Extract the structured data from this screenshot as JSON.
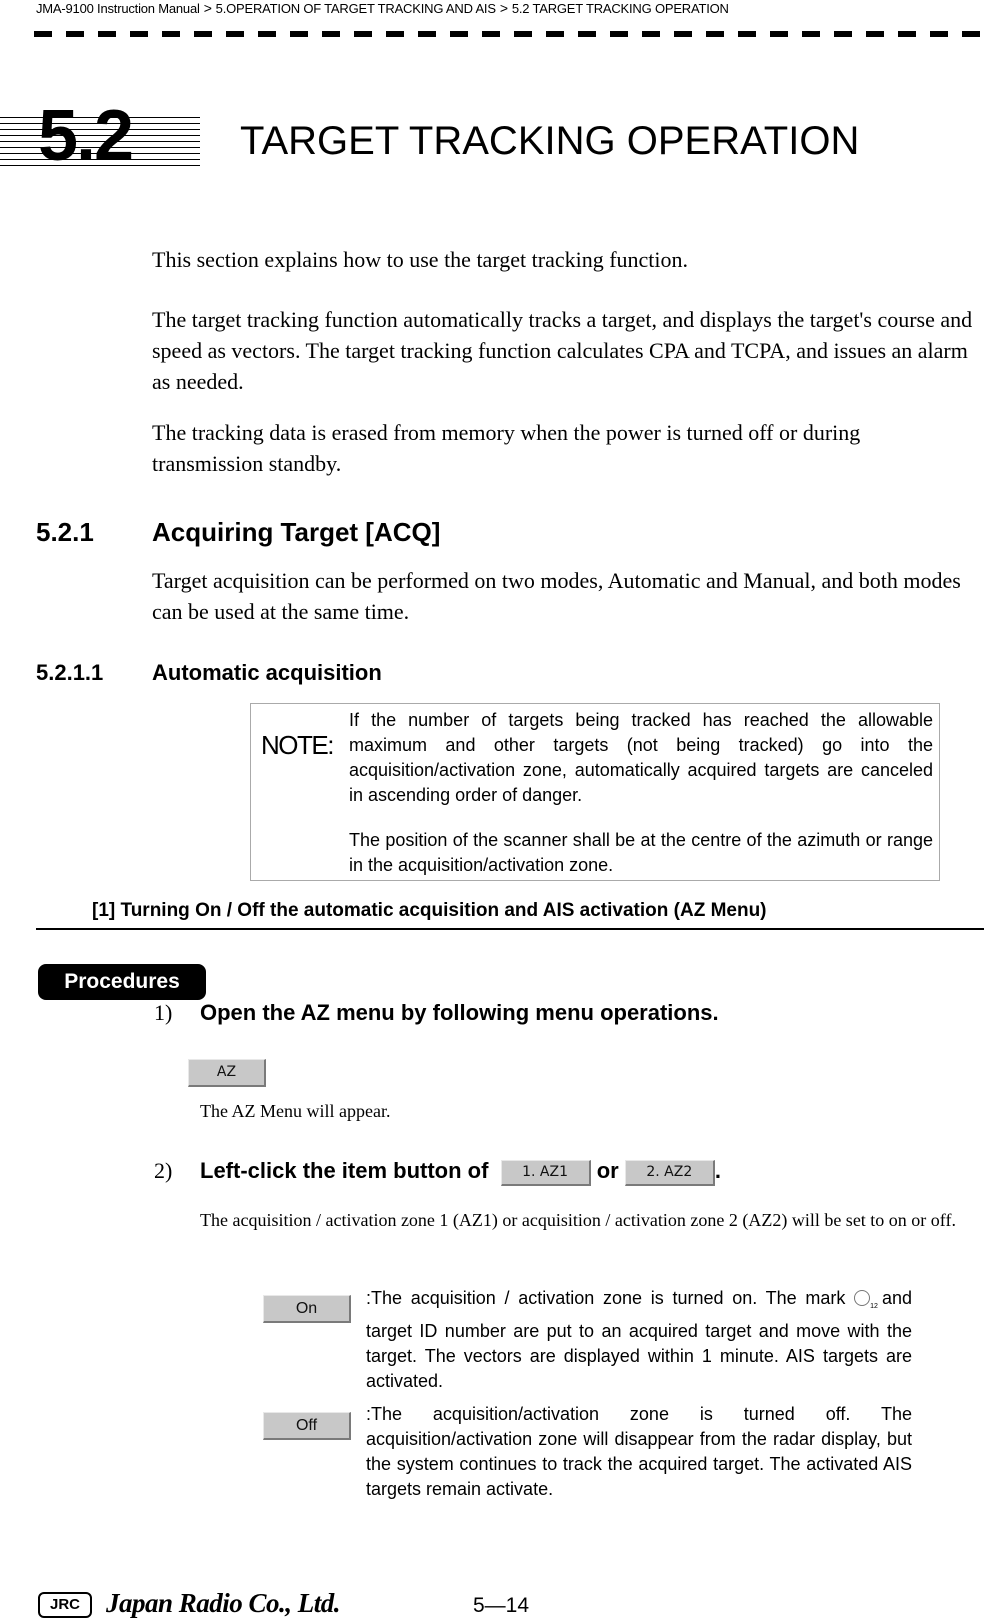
{
  "breadcrumb": {
    "items": [
      "JMA-9100 Instruction Manual",
      "5.OPERATION OF TARGET TRACKING AND AIS",
      "5.2  TARGET TRACKING OPERATION"
    ],
    "separator": ">"
  },
  "chapter": {
    "number": "5.2",
    "title": "TARGET TRACKING OPERATION"
  },
  "intro": {
    "paragraphs": [
      "This section explains how to use the target tracking function.",
      "The target tracking function automatically tracks a target, and displays the target's course and speed as vectors. The target tracking function calculates CPA and TCPA, and issues an alarm as needed.",
      "The tracking data is erased from memory when the power is turned off or during transmission standby."
    ]
  },
  "section_521": {
    "number": "5.2.1",
    "title": "Acquiring Target [ACQ]",
    "text": "Target acquisition can be performed on two modes, Automatic and Manual, and both modes can be used at the same time."
  },
  "section_5211": {
    "number": "5.2.1.1",
    "title": "Automatic acquisition"
  },
  "note": {
    "label": "NOTE:",
    "paragraphs": [
      "If the number of targets being tracked has reached the allowable maximum and other targets (not being tracked) go into the acquisition/activation zone, automatically acquired targets are canceled in ascending order of danger.",
      "The position of the scanner shall be at the centre of the azimuth or range in the acquisition/activation zone."
    ]
  },
  "subsection": {
    "title": "[1] Turning On / Off the automatic acquisition and AIS activation (AZ Menu)"
  },
  "procedures": {
    "badge": "Procedures",
    "steps": [
      {
        "number": "1)",
        "text": "Open the AZ menu by following menu operations.",
        "button": "AZ",
        "result": "The AZ Menu will appear."
      },
      {
        "number": "2)",
        "text_before": "Left-click the item button of",
        "button1": "1. AZ1",
        "connector": "or",
        "button2": "2. AZ2",
        "text_after": ".",
        "result": "The acquisition / activation zone 1 (AZ1) or acquisition / activation zone 2 (AZ2) will be set to on or off."
      }
    ],
    "options": [
      {
        "button": "On",
        "text_before": ":The acquisition / activation zone is turned on. The mark",
        "mark_sub": "12",
        "text_after": "and target ID number are put to an acquired target and move with the target. The vectors are displayed within 1 minute. AIS targets are activated."
      },
      {
        "button": "Off",
        "text": ":The acquisition/activation zone is turned off. The acquisition/activation zone will disappear from the radar display, but the system continues to track the acquired target. The activated AIS targets remain activate."
      }
    ]
  },
  "footer": {
    "logo": "JRC",
    "company": "Japan Radio Co., Ltd.",
    "page": "5—14"
  }
}
